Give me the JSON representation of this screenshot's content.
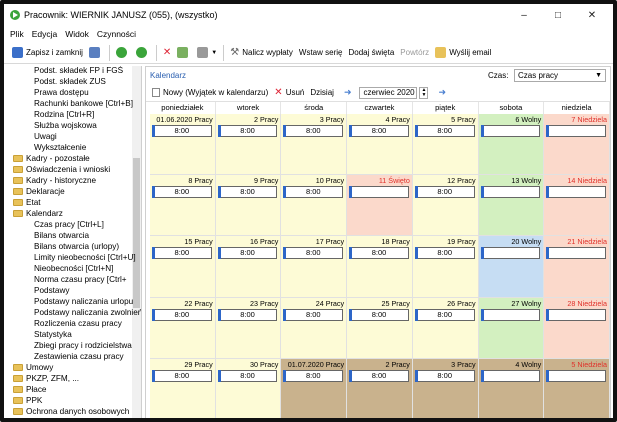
{
  "window": {
    "title": "Pracownik: WIERNIK JANUSZ (055), (wszystko)"
  },
  "menu": [
    "Plik",
    "Edycja",
    "Widok",
    "Czynności"
  ],
  "toolbar": {
    "save_close": "Zapisz i zamknij",
    "recalc": "Nalicz wypłaty",
    "insert_series": "Wstaw serię",
    "add_holidays": "Dodaj święta",
    "repeat": "Powtórz",
    "send_email": "Wyślij email"
  },
  "tree": [
    {
      "label": "Podst. składek FP i FGŚ",
      "indent": 1,
      "folder": false
    },
    {
      "label": "Podst. składek ZUS",
      "indent": 1,
      "folder": false
    },
    {
      "label": "Prawa dostępu",
      "indent": 1,
      "folder": false
    },
    {
      "label": "Rachunki bankowe [Ctrl+B]",
      "indent": 1,
      "folder": false
    },
    {
      "label": "Rodzina [Ctrl+R]",
      "indent": 1,
      "folder": false
    },
    {
      "label": "Służba wojskowa",
      "indent": 1,
      "folder": false
    },
    {
      "label": "Uwagi",
      "indent": 1,
      "folder": false
    },
    {
      "label": "Wykształcenie",
      "indent": 1,
      "folder": false
    },
    {
      "label": "Kadry - pozostałe",
      "indent": 0,
      "folder": true
    },
    {
      "label": "Oświadczenia i wnioski",
      "indent": 0,
      "folder": true
    },
    {
      "label": "Kadry - historyczne",
      "indent": 0,
      "folder": true
    },
    {
      "label": "Deklaracje",
      "indent": 0,
      "folder": true
    },
    {
      "label": "Etat",
      "indent": 0,
      "folder": true
    },
    {
      "label": "Kalendarz",
      "indent": 0,
      "folder": true
    },
    {
      "label": "Czas pracy [Ctrl+L]",
      "indent": 1,
      "folder": false
    },
    {
      "label": "Bilans otwarcia",
      "indent": 1,
      "folder": false
    },
    {
      "label": "Bilans otwarcia (urlopy)",
      "indent": 1,
      "folder": false
    },
    {
      "label": "Limity nieobecności [Ctrl+U]",
      "indent": 1,
      "folder": false
    },
    {
      "label": "Nieobecności [Ctrl+N]",
      "indent": 1,
      "folder": false
    },
    {
      "label": "Norma czasu pracy [Ctrl+",
      "indent": 1,
      "folder": false,
      "marker": true
    },
    {
      "label": "Podstawy",
      "indent": 1,
      "folder": false
    },
    {
      "label": "Podstawy naliczania urlopu",
      "indent": 1,
      "folder": false
    },
    {
      "label": "Podstawy naliczania zwolnień",
      "indent": 1,
      "folder": false
    },
    {
      "label": "Rozliczenia czasu pracy",
      "indent": 1,
      "folder": false
    },
    {
      "label": "Statystyka",
      "indent": 1,
      "folder": false
    },
    {
      "label": "Zbiegi pracy i rodzicielstwa",
      "indent": 1,
      "folder": false
    },
    {
      "label": "Zestawienia czasu pracy",
      "indent": 1,
      "folder": false
    },
    {
      "label": "Umowy",
      "indent": 0,
      "folder": true
    },
    {
      "label": "PKZP, ZFM, ...",
      "indent": 0,
      "folder": true
    },
    {
      "label": "Płace",
      "indent": 0,
      "folder": true
    },
    {
      "label": "PPK",
      "indent": 0,
      "folder": true
    },
    {
      "label": "Ochrona danych osobowych",
      "indent": 0,
      "folder": true
    }
  ],
  "panel": {
    "caption": "Kalendarz",
    "czas_label": "Czas:",
    "czas_value": "Czas pracy",
    "new_btn": "Nowy (Wyjątek w kalendarzu)",
    "delete_btn": "Usuń",
    "today_btn": "Dzisiaj",
    "month": "czerwiec 2020"
  },
  "colors": {
    "weekday": "#fdfbd6",
    "saturday": "#d3f0c0",
    "sunday": "#fbd9cb",
    "holiday": "#fbd9cb",
    "today": "#c6ddf3",
    "next_month": "#c9b28d",
    "accent": "#2d66c8"
  },
  "calendar": {
    "days": [
      "poniedziałek",
      "wtorek",
      "środa",
      "czwartek",
      "piątek",
      "sobota",
      "niedziela"
    ],
    "weeks": [
      [
        {
          "label": "01.06.2020 Pracy",
          "type": "weekday",
          "time": "8:00"
        },
        {
          "label": "2 Pracy",
          "type": "weekday",
          "time": "8:00"
        },
        {
          "label": "3 Pracy",
          "type": "weekday",
          "time": "8:00"
        },
        {
          "label": "4 Pracy",
          "type": "weekday",
          "time": "8:00"
        },
        {
          "label": "5 Pracy",
          "type": "weekday",
          "time": "8:00"
        },
        {
          "label": "6 Wolny",
          "type": "saturday",
          "time": ""
        },
        {
          "label": "7 Niedziela",
          "type": "sunday",
          "time": "",
          "red": true
        }
      ],
      [
        {
          "label": "8 Pracy",
          "type": "weekday",
          "time": "8:00"
        },
        {
          "label": "9 Pracy",
          "type": "weekday",
          "time": "8:00"
        },
        {
          "label": "10 Pracy",
          "type": "weekday",
          "time": "8:00"
        },
        {
          "label": "11 Święto",
          "type": "holiday",
          "time": "",
          "red": true
        },
        {
          "label": "12 Pracy",
          "type": "weekday",
          "time": "8:00"
        },
        {
          "label": "13 Wolny",
          "type": "saturday",
          "time": ""
        },
        {
          "label": "14 Niedziela",
          "type": "sunday",
          "time": "",
          "red": true
        }
      ],
      [
        {
          "label": "15 Pracy",
          "type": "weekday",
          "time": "8:00"
        },
        {
          "label": "16 Pracy",
          "type": "weekday",
          "time": "8:00"
        },
        {
          "label": "17 Pracy",
          "type": "weekday",
          "time": "8:00"
        },
        {
          "label": "18 Pracy",
          "type": "weekday",
          "time": "8:00"
        },
        {
          "label": "19 Pracy",
          "type": "weekday",
          "time": "8:00"
        },
        {
          "label": "20 Wolny",
          "type": "today",
          "time": ""
        },
        {
          "label": "21 Niedziela",
          "type": "sunday",
          "time": "",
          "red": true
        }
      ],
      [
        {
          "label": "22 Pracy",
          "type": "weekday",
          "time": "8:00"
        },
        {
          "label": "23 Pracy",
          "type": "weekday",
          "time": "8:00"
        },
        {
          "label": "24 Pracy",
          "type": "weekday",
          "time": "8:00"
        },
        {
          "label": "25 Pracy",
          "type": "weekday",
          "time": "8:00"
        },
        {
          "label": "26 Pracy",
          "type": "weekday",
          "time": "8:00"
        },
        {
          "label": "27 Wolny",
          "type": "saturday",
          "time": ""
        },
        {
          "label": "28 Niedziela",
          "type": "sunday",
          "time": "",
          "red": true
        }
      ],
      [
        {
          "label": "29 Pracy",
          "type": "weekday",
          "time": "8:00"
        },
        {
          "label": "30 Pracy",
          "type": "weekday",
          "time": "8:00"
        },
        {
          "label": "01.07.2020 Pracy",
          "type": "next_month",
          "time": "8:00"
        },
        {
          "label": "2 Pracy",
          "type": "next_month",
          "time": "8:00"
        },
        {
          "label": "3 Pracy",
          "type": "next_month",
          "time": "8:00"
        },
        {
          "label": "4 Wolny",
          "type": "next_month",
          "time": ""
        },
        {
          "label": "5 Niedziela",
          "type": "next_month",
          "time": "",
          "red": true
        }
      ]
    ]
  }
}
